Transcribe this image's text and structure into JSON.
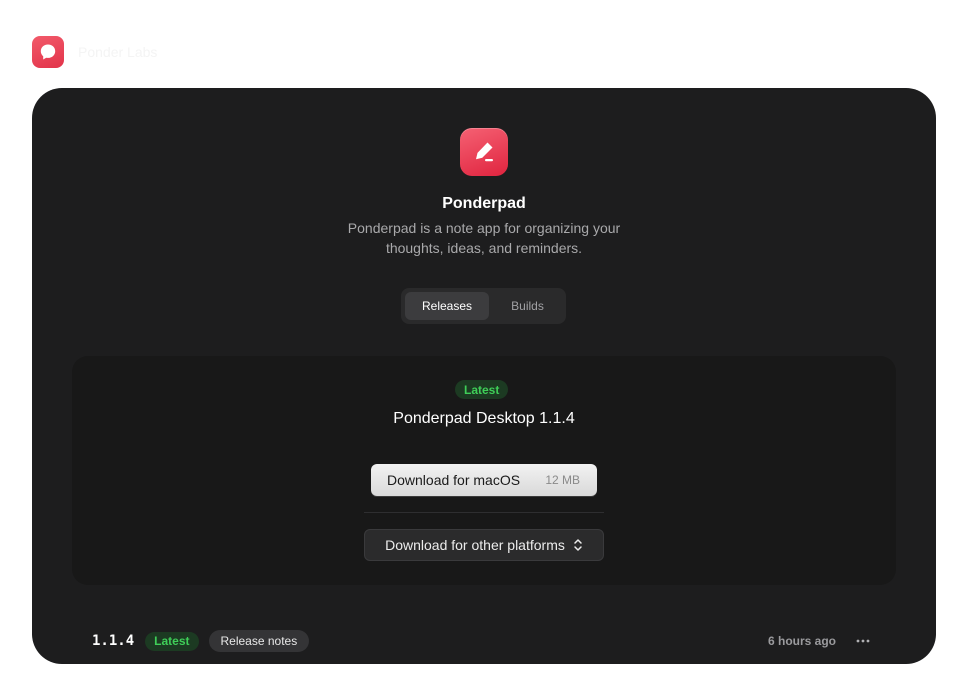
{
  "brand": {
    "name": "Ponder Labs",
    "icon": "chat-bubble-icon"
  },
  "app": {
    "name": "Ponderpad",
    "description": "Ponderpad is a note app for organizing your thoughts, ideas, and reminders.",
    "icon": "pencil-icon",
    "accent": "#e8344c"
  },
  "tabs": [
    {
      "label": "Releases",
      "active": true
    },
    {
      "label": "Builds",
      "active": false
    }
  ],
  "latest_release": {
    "badge": "Latest",
    "title": "Ponderpad Desktop 1.1.4",
    "primary_download": {
      "label": "Download for macOS",
      "size": "12 MB"
    },
    "other_download": {
      "label": "Download for other platforms",
      "icon": "chevron-up-down-icon"
    }
  },
  "release_list": [
    {
      "version": "1.1.4",
      "badge": "Latest",
      "notes_label": "Release notes",
      "time": "6 hours ago",
      "menu_icon": "more-horizontal-icon"
    }
  ],
  "colors": {
    "panel_bg": "#1d1d1e",
    "card_bg": "#181818",
    "latest_badge_bg": "#1c3a22",
    "latest_badge_text": "#3fce58"
  }
}
